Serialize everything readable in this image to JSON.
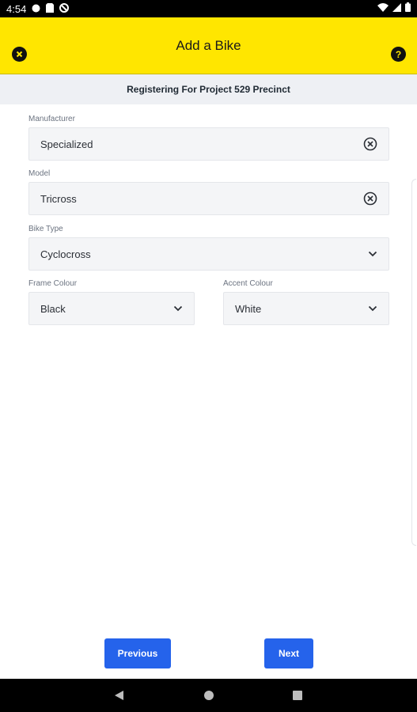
{
  "status_bar": {
    "time": "4:54"
  },
  "header": {
    "title": "Add a Bike",
    "help_glyph": "?"
  },
  "subheader": {
    "text": "Registering For Project 529 Precinct"
  },
  "form": {
    "manufacturer": {
      "label": "Manufacturer",
      "value": "Specialized"
    },
    "model": {
      "label": "Model",
      "value": "Tricross"
    },
    "bike_type": {
      "label": "Bike Type",
      "value": "Cyclocross"
    },
    "frame_colour": {
      "label": "Frame Colour",
      "value": "Black"
    },
    "accent_colour": {
      "label": "Accent Colour",
      "value": "White"
    }
  },
  "buttons": {
    "previous": "Previous",
    "next": "Next"
  },
  "colors": {
    "header_bg": "#ffe600",
    "primary_button": "#2563eb",
    "subheader_bg": "#eef0f4"
  }
}
